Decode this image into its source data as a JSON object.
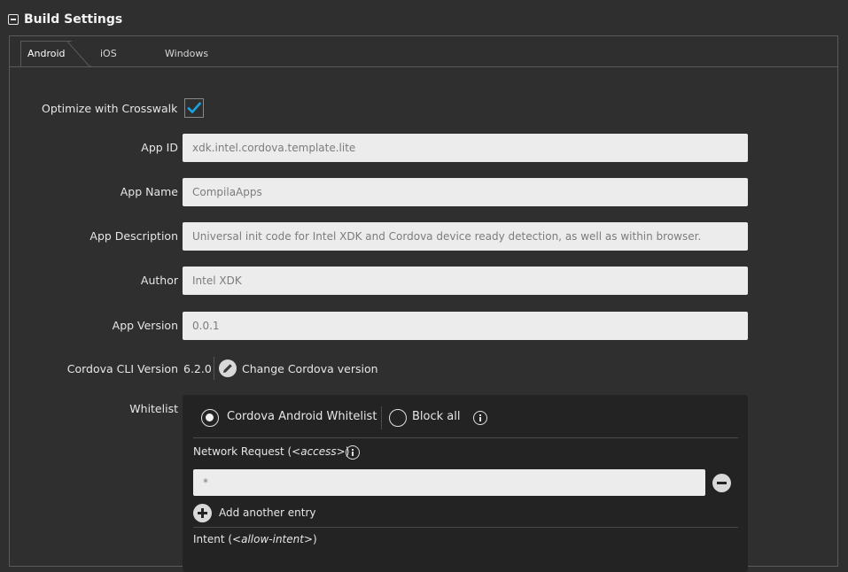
{
  "section": {
    "title": "Build Settings",
    "collapse_icon": "minus-square-icon"
  },
  "tabs": [
    {
      "label": "Android",
      "active": true
    },
    {
      "label": "iOS",
      "active": false
    },
    {
      "label": "Windows",
      "active": false
    }
  ],
  "crosswalk": {
    "label": "Optimize with Crosswalk",
    "checked": true,
    "check_color": "#1aa3df"
  },
  "fields": {
    "app_id": {
      "label": "App ID",
      "value": "xdk.intel.cordova.template.lite"
    },
    "app_name": {
      "label": "App Name",
      "value": "CompilaApps"
    },
    "app_description": {
      "label": "App Description",
      "value": "Universal init code for Intel XDK and Cordova device ready detection, as well as within browser."
    },
    "author": {
      "label": "Author",
      "value": "Intel XDK"
    },
    "app_version": {
      "label": "App Version",
      "value": "0.0.1"
    }
  },
  "cordova": {
    "label": "Cordova CLI Version",
    "version": "6.2.0",
    "change_label": "Change Cordova version"
  },
  "whitelist": {
    "label": "Whitelist",
    "options": [
      {
        "label": "Cordova Android Whitelist",
        "selected": true
      },
      {
        "label": "Block all",
        "selected": false
      }
    ],
    "network_request_label_prefix": "Network Request (",
    "network_request_tag": "<access>",
    "network_request_label_suffix": ")",
    "entry_value": "*",
    "add_label": "Add another entry",
    "intent_label_prefix": "Intent (",
    "intent_tag": "<allow-intent>",
    "intent_label_suffix": ")"
  }
}
